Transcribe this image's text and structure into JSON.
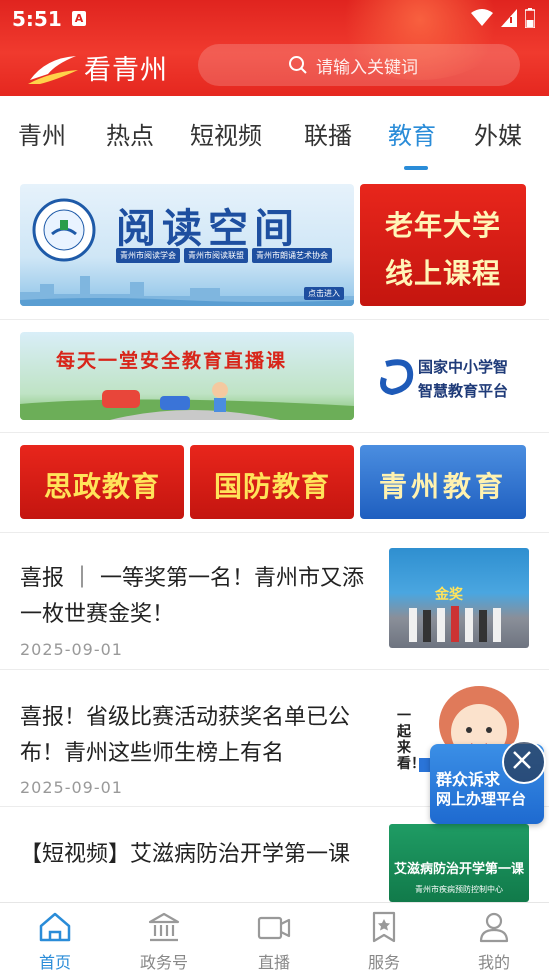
{
  "status_bar": {
    "time": "5:51",
    "sim_badge": "A"
  },
  "header": {
    "app_name": "看青州",
    "search": {
      "placeholder": "请输入关键词"
    }
  },
  "tabs": [
    {
      "label": "青州",
      "active": false
    },
    {
      "label": "热点",
      "active": false
    },
    {
      "label": "短视频",
      "active": false
    },
    {
      "label": "联播",
      "active": false
    },
    {
      "label": "教育",
      "active": true
    },
    {
      "label": "外媒",
      "active": false
    }
  ],
  "banners": {
    "row1": {
      "reading_space": {
        "title": "阅读空间",
        "orgs": [
          "青州市阅读学会",
          "青州市阅读联盟",
          "青州市朗诵艺术协会"
        ],
        "enter": "点击进入"
      },
      "senior_univ": {
        "line1": "老年大学",
        "line2": "线上课程"
      }
    },
    "row2": {
      "safety": {
        "title": "每天一堂安全教育直播课"
      },
      "platform": {
        "line1": "国家中小学智",
        "line2": "智慧教育平台"
      }
    },
    "row3": {
      "ideology": "思政教育",
      "defense": "国防教育",
      "qingzhou_edu": "青州教育"
    }
  },
  "news": [
    {
      "title": "喜报 ｜ 一等奖第一名！青州市又添一枚世赛金奖！",
      "date": "2025-09-01",
      "thumb_text": "金奖"
    },
    {
      "title": "喜报！省级比赛活动获奖名单已公布！青州这些师生榜上有名",
      "date": "2025-09-01",
      "thumb_text": "一起来看！"
    },
    {
      "title": "【短视频】艾滋病防治开学第一课",
      "date": "",
      "thumb_text": "艾滋病防治开学第一课",
      "thumb_sub": "青州市疾病预防控制中心"
    }
  ],
  "floating": {
    "line1": "群众诉求",
    "line2": "网上办理平台"
  },
  "bottom_nav": [
    {
      "label": "首页",
      "icon": "home-icon",
      "active": true
    },
    {
      "label": "政务号",
      "icon": "government-icon",
      "active": false
    },
    {
      "label": "直播",
      "icon": "video-camera-icon",
      "active": false
    },
    {
      "label": "服务",
      "icon": "bookmark-star-icon",
      "active": false
    },
    {
      "label": "我的",
      "icon": "user-icon",
      "active": false
    }
  ],
  "colors": {
    "brand_red": "#e0241f",
    "accent_blue": "#2a8cd8"
  }
}
